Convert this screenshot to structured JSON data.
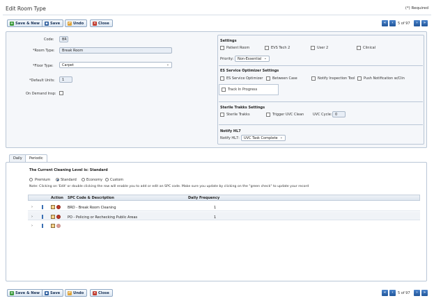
{
  "page": {
    "title": "Edit Room Type",
    "required_note": "(*) Required"
  },
  "toolbar": {
    "save_new": "Save & New",
    "save": "Save",
    "undo": "Undo",
    "close": "Close"
  },
  "pager": {
    "text": "5 of 97",
    "first": "«",
    "prev": "‹",
    "next": "›",
    "last": "»"
  },
  "form": {
    "code_label": "Code:",
    "code_value": "BR",
    "room_type_label": "*Room Type:",
    "room_type_value": "Break Room",
    "floor_type_label": "*Floor Type:",
    "floor_type_value": "Carpet",
    "default_units_label": "*Default Units:",
    "default_units_value": "1",
    "on_demand_label": "On Demand Insp:"
  },
  "settings": {
    "title": "Settings",
    "patient_room": "Patient Room",
    "evs_tech2": "EVS Tech 2",
    "user2": "User 2",
    "clinical": "Clinical",
    "priority_label": "Priority:",
    "priority_value": "Non-Essential",
    "es_title": "ES Service Optimizer Settings",
    "es_optimizer": "ES Service Optimizer",
    "between_case": "Between Case",
    "notify_tool": "Notify Inspection Tool",
    "push_notif": "Push Notification w/Clin",
    "track_progress": "Track In Progress",
    "sterile_title": "Sterile Trakks Settings",
    "sterile_trakks": "Sterile Trakks",
    "trigger_uvc": "Trigger UVC Clean",
    "uvc_cycle_label": "UVC Cycle:",
    "uvc_cycle_value": "0",
    "notify_title": "Notify HL7",
    "notify_label": "Notify HL7:",
    "notify_value": "UVC Task Complete"
  },
  "tabs": {
    "daily": "Daily",
    "periodic": "Periodic"
  },
  "cleaning": {
    "level_text": "The Current Cleaning Level is: Standard",
    "premium": "Premium",
    "standard": "Standard",
    "economy": "Economy",
    "custom": "Custom",
    "note": "Note: Clicking on 'Edit' or double clicking the row will enable you to add or edit an SPC code. Make sure you update by clicking on the \"green check\" to update your record"
  },
  "grid": {
    "col_action": "Action",
    "col_spc": "SPC Code & Description",
    "col_freq": "Daily Frequency",
    "rows": [
      {
        "spc": "BRD - Break Room Cleaning",
        "freq": "1"
      },
      {
        "spc": "PO - Policing or Rechecking Public Areas",
        "freq": "1"
      }
    ]
  }
}
